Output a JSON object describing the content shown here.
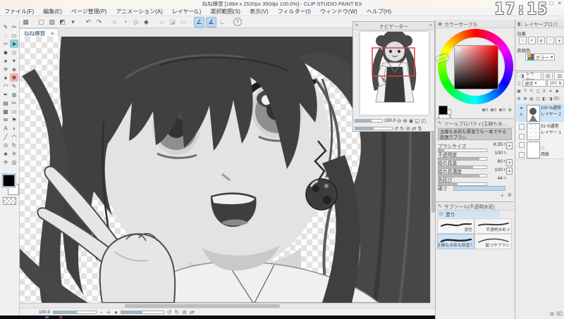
{
  "desktop": {
    "clock": "17:15"
  },
  "window": {
    "title": "ねね練習 [1864 x 2520px 350dpi 100.0%] - CLIP STUDIO PAINT EX",
    "minimize": "–",
    "maximize": "□",
    "close": "×"
  },
  "menubar": {
    "items": [
      "ファイル(F)",
      "編集(E)",
      "ページ管理(P)",
      "アニメーション(A)",
      "レイヤー(L)",
      "選択範囲(S)",
      "表示(V)",
      "フィルター(I)",
      "ウィンドウ(W)",
      "ヘルプ(H)"
    ]
  },
  "toolbar": {
    "icons": [
      {
        "name": "workspace-icon",
        "glyph": "▦"
      },
      {
        "name": "new-file-icon",
        "glyph": "▢"
      },
      {
        "name": "open-file-icon",
        "glyph": "▧"
      },
      {
        "name": "save-icon",
        "glyph": "◩"
      },
      {
        "name": "save-menu-arrow-icon",
        "glyph": "▾"
      },
      {
        "name": "undo-icon",
        "glyph": "↶"
      },
      {
        "name": "redo-icon",
        "glyph": "↷"
      },
      {
        "name": "deselect-icon",
        "glyph": "○"
      },
      {
        "name": "reselect-icon",
        "glyph": "◔"
      },
      {
        "name": "clear-icon",
        "glyph": "◇"
      },
      {
        "name": "fill-icon",
        "glyph": "◆"
      },
      {
        "name": "scale-icon",
        "glyph": "▱"
      },
      {
        "name": "gradient-icon",
        "glyph": "◪"
      },
      {
        "name": "frame-icon",
        "glyph": "▭"
      },
      {
        "name": "snap-ruler-icon",
        "glyph": "∠",
        "active": true
      },
      {
        "name": "snap-special-ruler-icon",
        "glyph": "∡",
        "active": true
      },
      {
        "name": "snap-grid-icon",
        "glyph": "∟"
      },
      {
        "name": "help-icon",
        "glyph": "?"
      }
    ]
  },
  "document_tab": {
    "label": "ねね練習",
    "close": "×"
  },
  "tool_palette": {
    "tools": [
      {
        "name": "pen-tool",
        "glyph": "✎"
      },
      {
        "name": "pencil-tool",
        "glyph": "✏"
      },
      {
        "name": "lasso-tool",
        "glyph": "◌"
      },
      {
        "name": "marquee-tool",
        "glyph": "▭"
      },
      {
        "name": "eyedrop-pen-tool",
        "glyph": "✑"
      },
      {
        "name": "operation-tool",
        "glyph": "➤",
        "state": "teal"
      },
      {
        "name": "bucket-tool",
        "glyph": "◆"
      },
      {
        "name": "eraser-tool",
        "glyph": "◇"
      },
      {
        "name": "decoration-tool",
        "glyph": "♠"
      },
      {
        "name": "airbrush-tool",
        "glyph": "✦"
      },
      {
        "name": "correction-tool",
        "glyph": "✛"
      },
      {
        "name": "mix-tool",
        "glyph": "◈"
      },
      {
        "name": "brush-tool",
        "glyph": "♠"
      },
      {
        "name": "blend-tool",
        "glyph": "❋",
        "state": "pink"
      },
      {
        "name": "curve-tool",
        "glyph": "◠"
      },
      {
        "name": "ink-pen-tool",
        "glyph": "✎"
      },
      {
        "name": "marker-tool",
        "glyph": "✒"
      },
      {
        "name": "gradient-tool",
        "glyph": "◍"
      },
      {
        "name": "pattern-tool",
        "glyph": "▤"
      },
      {
        "name": "sketch-pencil-tool",
        "glyph": "✏"
      },
      {
        "name": "tone-tool",
        "glyph": "▦"
      },
      {
        "name": "frame-border-tool",
        "glyph": "▭"
      },
      {
        "name": "material-tool",
        "glyph": "✉"
      },
      {
        "name": "flag-tool",
        "glyph": "⚑"
      },
      {
        "name": "text-tool",
        "glyph": "A"
      },
      {
        "name": "balloon-tool",
        "glyph": "◗"
      },
      {
        "name": "line-tool",
        "glyph": "╱"
      },
      {
        "name": "figure-tool",
        "glyph": "◠"
      },
      {
        "name": "zoom-tool",
        "glyph": "⊙"
      },
      {
        "name": "rotate-canvas-tool",
        "glyph": "↻"
      },
      {
        "name": "leaf-brush-tool",
        "glyph": "♣"
      },
      {
        "name": "spark-brush-tool",
        "glyph": "✳"
      },
      {
        "name": "move-tool",
        "glyph": "✛"
      },
      {
        "name": "hand-tool",
        "glyph": "◎"
      }
    ],
    "foreground_color": "#000000",
    "background_color": "#ffffff"
  },
  "navigator": {
    "title": "ナビゲーター",
    "zoom_value": "100.0",
    "icons_row1": [
      {
        "name": "zoom-out-icon",
        "glyph": "⊖"
      },
      {
        "name": "zoom-in-icon",
        "glyph": "⊕"
      },
      {
        "name": "zoom-100-icon",
        "glyph": "◉"
      },
      {
        "name": "fit-screen-icon",
        "glyph": "◱"
      },
      {
        "name": "fit-window-icon",
        "glyph": "◰"
      }
    ],
    "icons_row2": [
      {
        "name": "rotate-ccw-icon",
        "glyph": "↺"
      },
      {
        "name": "rotate-cw-icon",
        "glyph": "↻"
      },
      {
        "name": "reset-rotation-icon",
        "glyph": "⊘"
      },
      {
        "name": "flip-horizontal-icon",
        "glyph": "⇄"
      },
      {
        "name": "flip-vertical-icon",
        "glyph": "⇅"
      }
    ]
  },
  "color_wheel": {
    "title": "カラーサークル",
    "values": [
      "0",
      "0",
      "0"
    ],
    "gear": "⚙",
    "selected_hue": "#ff0000"
  },
  "tool_property": {
    "title": "ツールプロパティ[主線も水彩も厚塗りも一本でやるやつ]",
    "brush_name": "主線も水彩も厚塗りも一本でやる欲張りブラシ",
    "sliders": [
      {
        "label": "ブラシサイズ",
        "value": "8.35"
      },
      {
        "label": "不透明度",
        "value": "100"
      },
      {
        "label": "絵の具量",
        "value": "80"
      },
      {
        "label": "絵の具濃度",
        "value": "100"
      },
      {
        "label": "色延び",
        "value": "44"
      }
    ],
    "hardness_label": "硬さ",
    "spin_glyph": "↻",
    "dyn_glyph": "▲",
    "footer_icons": [
      {
        "name": "add-setting-icon",
        "glyph": "＋"
      },
      {
        "name": "wrench-icon",
        "glyph": "⚙"
      }
    ]
  },
  "sub_tool": {
    "title": "サブツール[不透明水彩]",
    "group": "塗り",
    "items": [
      {
        "label": "混色"
      },
      {
        "label": "不透明水彩 2"
      },
      {
        "label": "主線も水彩も厚塗り…",
        "selected": true
      },
      {
        "label": "髪つやブラシ"
      }
    ]
  },
  "layer_property": {
    "title": "レイヤープロパティ",
    "effect_label": "効果",
    "effect_icons": [
      {
        "name": "border-effect-icon",
        "glyph": "○"
      },
      {
        "name": "layer-color-icon",
        "glyph": "◐"
      },
      {
        "name": "tone-effect-icon",
        "glyph": "※"
      },
      {
        "name": "extract-line-icon",
        "glyph": "◔"
      },
      {
        "name": "effect-menu-arrow-icon",
        "glyph": "▾"
      }
    ],
    "expression_label": "表現色",
    "expression_value": "カラー",
    "dropdown_arrow": "▾"
  },
  "layers": {
    "tab_label": "レイヤー",
    "blend_mode": "通常",
    "opacity": "100",
    "lock_icons": [
      {
        "name": "clip-mask-icon",
        "glyph": "▣"
      },
      {
        "name": "lock-layer-icon",
        "glyph": "≡"
      },
      {
        "name": "lock-transparent-icon",
        "glyph": "✎"
      },
      {
        "name": "mask-icon",
        "glyph": "◻"
      },
      {
        "name": "ruler-icon",
        "glyph": "⚓"
      },
      {
        "name": "set-menu-icon",
        "glyph": "▾"
      },
      {
        "name": "palette-menu-icon",
        "glyph": "◆"
      }
    ],
    "action_icons": [
      {
        "name": "new-layer-icon",
        "glyph": "⊞"
      },
      {
        "name": "new-vector-layer-icon",
        "glyph": "⊠"
      },
      {
        "name": "new-folder-icon",
        "glyph": "▤"
      },
      {
        "name": "transfer-layer-icon",
        "glyph": "◫"
      },
      {
        "name": "merge-layer-icon",
        "glyph": "◧"
      },
      {
        "name": "apply-mask-icon",
        "glyph": "◨"
      },
      {
        "name": "delete-layer-icon",
        "glyph": "⌦"
      }
    ],
    "rows": [
      {
        "name": "レイヤー 2",
        "info": "100 %通常",
        "selected": true,
        "eye": "●",
        "edit": "✎"
      },
      {
        "name": "レイヤー 1",
        "info": "31 %通常"
      },
      {
        "name": "用紙",
        "info": ""
      }
    ],
    "footer_icons": [
      {
        "name": "two-pane-icon",
        "glyph": "⊞"
      },
      {
        "name": "trash-footer-icon",
        "glyph": "⌦"
      }
    ]
  },
  "status_bar": {
    "zoom": "100.0",
    "icons": [
      {
        "name": "status-zoom-out-icon",
        "glyph": "−"
      },
      {
        "name": "status-zoom-in-icon",
        "glyph": "＋"
      },
      {
        "name": "status-zoom-100-icon",
        "glyph": "●"
      },
      {
        "name": "status-rotate-ccw-icon",
        "glyph": "↺"
      },
      {
        "name": "status-rotate-cw-icon",
        "glyph": "↻"
      },
      {
        "name": "status-reset-icon",
        "glyph": "⊘"
      },
      {
        "name": "status-flip-icon",
        "glyph": "⇄"
      }
    ]
  }
}
